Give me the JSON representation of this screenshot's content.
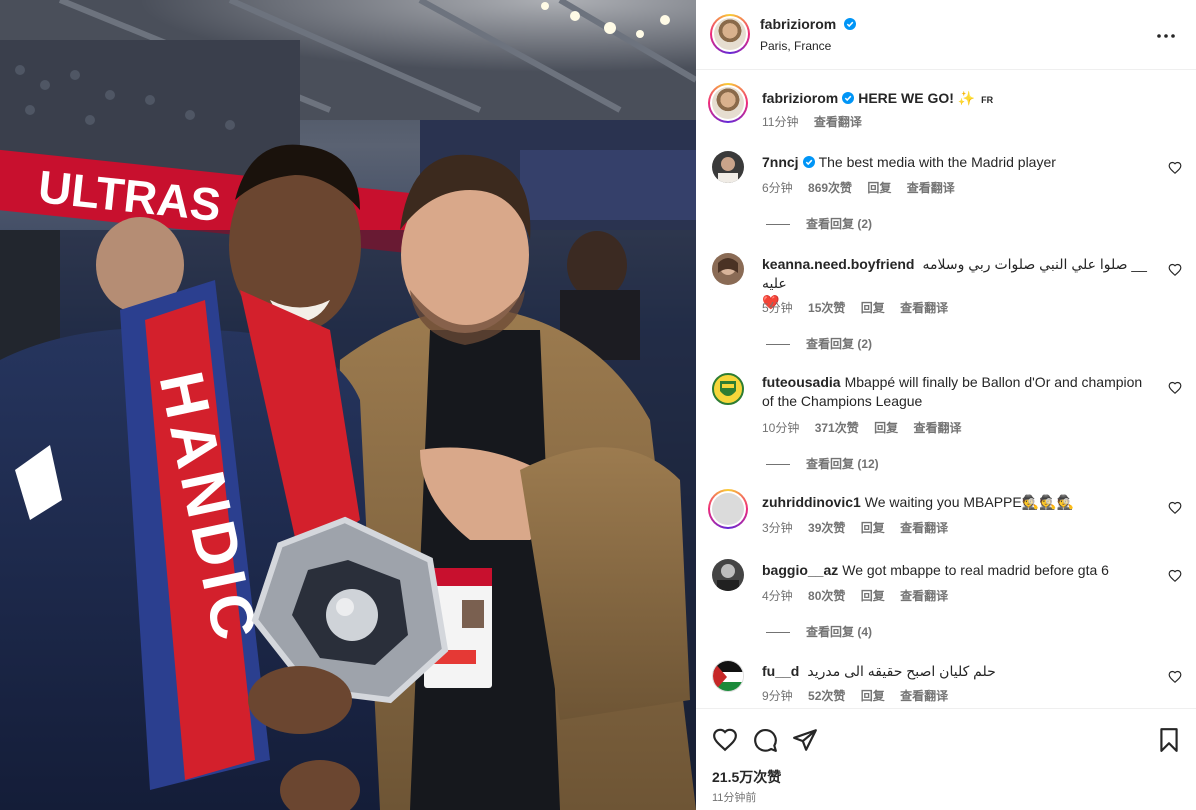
{
  "post": {
    "username": "fabriziorom",
    "location": "Paris, France",
    "caption_username": "fabriziorom",
    "caption_text": "HERE WE GO! ✨",
    "caption_flag": "FR",
    "caption_time": "11分钟",
    "caption_translate": "查看翻译",
    "banner_text": "ULTRAS",
    "scarf_text": "HANDIC"
  },
  "comments": [
    {
      "username": "7nncj",
      "verified": true,
      "text": "The best media with the Madrid player",
      "time": "6分钟",
      "likes": "869次赞",
      "reply": "回复",
      "translate": "查看翻译",
      "view_replies": "查看回复 (2)",
      "avatar_color": "#3a3a3a"
    },
    {
      "username": "keanna.need.boyfriend",
      "verified": false,
      "text": "__ صلوا علي النبي صلوات ربي وسلامه",
      "text2": "عليه ❤️",
      "time": "5分钟",
      "likes": "15次赞",
      "reply": "回复",
      "translate": "查看翻译",
      "view_replies": "查看回复 (2)",
      "avatar_color": "#8a6b55"
    },
    {
      "username": "futeousadia",
      "verified": false,
      "text": "Mbappé will finally be Ballon d'Or and champion of the Champions League",
      "time": "10分钟",
      "likes": "371次赞",
      "reply": "回复",
      "translate": "查看翻译",
      "view_replies": "查看回复 (12)",
      "avatar_color": "#2e7d32"
    },
    {
      "username": "zuhriddinovic1",
      "verified": false,
      "text": "We waiting you MBAPPE🕵🕵🕵",
      "time": "3分钟",
      "likes": "39次赞",
      "reply": "回复",
      "translate": "查看翻译",
      "avatar_color": "#dbdbdb"
    },
    {
      "username": "baggio__az",
      "verified": false,
      "text": "We got mbappe to real madrid before gta 6",
      "time": "4分钟",
      "likes": "80次赞",
      "reply": "回复",
      "translate": "查看翻译",
      "view_replies": "查看回复 (4)",
      "avatar_color": "#444444"
    },
    {
      "username": "fu__d",
      "verified": false,
      "text": "حلم كليان اصبح حقيقه الى مدريد",
      "time": "9分钟",
      "likes": "52次赞",
      "reply": "回复",
      "translate": "查看翻译",
      "avatar_color": "#c62828"
    }
  ],
  "footer": {
    "likes": "21.5万次赞",
    "time_ago": "11分钟前"
  },
  "icons": {
    "header": [
      "verified-icon",
      "more-options-icon"
    ],
    "actions": [
      "heart-icon",
      "comment-icon",
      "share-icon",
      "bookmark-icon"
    ]
  },
  "colors": {
    "verified": "#0095f6",
    "muted": "#737373",
    "text": "#262626",
    "heart": "#ed4956"
  }
}
